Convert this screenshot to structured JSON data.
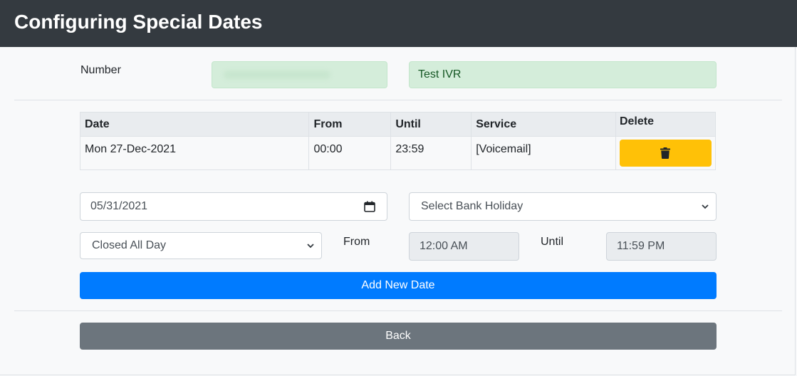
{
  "header": {
    "title": "Configuring Special Dates"
  },
  "number": {
    "label": "Number",
    "name_value": "Test IVR"
  },
  "table": {
    "headers": [
      "Date",
      "From",
      "Until",
      "Service",
      "Delete"
    ],
    "rows": [
      {
        "date": "Mon 27-Dec-2021",
        "from": "00:00",
        "until": "23:59",
        "service": "[Voicemail]",
        "delete_icon": "trash-icon"
      }
    ]
  },
  "form": {
    "date_value": "05/31/2021",
    "bank_holiday_select": "Select Bank Holiday",
    "closed_select": "Closed All Day",
    "from_label": "From",
    "from_value": "12:00 AM",
    "until_label": "Until",
    "until_value": "11:59 PM",
    "add_button": "Add New Date",
    "back_button": "Back"
  },
  "colors": {
    "header_bg": "#343a40",
    "success_bg": "#d4edda",
    "warning": "#ffc107",
    "primary": "#007bff",
    "secondary": "#6c757d"
  }
}
